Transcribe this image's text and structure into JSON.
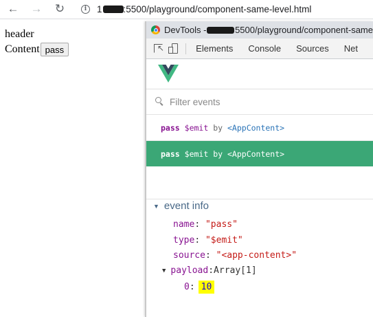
{
  "browser": {
    "url_prefix": "1",
    "url_rest": ":5500/playground/component-same-level.html",
    "back_icon": "arrow-left-icon",
    "forward_icon": "arrow-right-icon",
    "reload_icon": "reload-icon",
    "info_icon": "info-icon"
  },
  "page": {
    "header_text": "header",
    "content_text": "Content",
    "pass_button": "pass"
  },
  "devtools": {
    "title_prefix": "DevTools - ",
    "title_rest": "5500/playground/component-same",
    "tabs": [
      "Elements",
      "Console",
      "Sources",
      "Net"
    ],
    "filter_placeholder": "Filter events",
    "events": [
      {
        "name": "pass",
        "emit": "$emit",
        "by": "by",
        "component": "<AppContent>"
      },
      {
        "name": "pass",
        "emit": "$emit",
        "by": "by",
        "component": "<AppContent>"
      }
    ],
    "event_info": {
      "title": "event info",
      "name_key": "name",
      "name_val": "\"pass\"",
      "type_key": "type",
      "type_val": "\"$emit\"",
      "source_key": "source",
      "source_val": "\"<app-content>\"",
      "payload_key": "payload",
      "payload_val": "Array[1]",
      "index_key": "0",
      "index_val": "10"
    },
    "colors": {
      "selected_row": "#3ba776",
      "vue_green": "#41b883",
      "vue_dark": "#34495e",
      "highlight": "#ffff00"
    }
  }
}
